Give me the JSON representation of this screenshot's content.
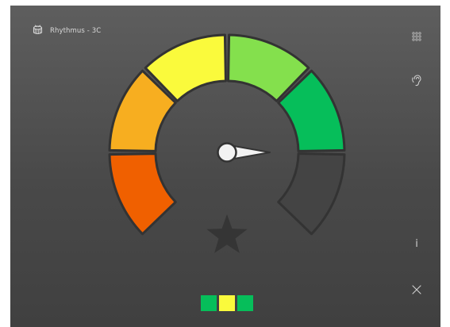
{
  "app": {
    "title": "Rhythmus - 3C",
    "logo_icon": "drum-icon"
  },
  "side_toolbar": {
    "grid_icon": "grid-dots-icon",
    "listen_icon": "ear-icon",
    "info_label": "i",
    "close_icon": "close-icon"
  },
  "gauge": {
    "segment_count": 6,
    "segments": [
      {
        "name": "red",
        "color": "#f06000"
      },
      {
        "name": "orange",
        "color": "#f7ae20"
      },
      {
        "name": "yellow",
        "color": "#fafa3c"
      },
      {
        "name": "light-green",
        "color": "#84e04d"
      },
      {
        "name": "green",
        "color": "#06be5a"
      },
      {
        "name": "empty",
        "color": "#444444"
      }
    ],
    "needle_icon": "needle-pointer-icon",
    "needle_color": "#f2f2f2",
    "star_icon": "star-icon",
    "star_color": "#353535"
  },
  "result": {
    "squares": [
      {
        "color": "#06be5a"
      },
      {
        "color": "#fafa3c"
      },
      {
        "color": "#06be5a"
      }
    ]
  }
}
